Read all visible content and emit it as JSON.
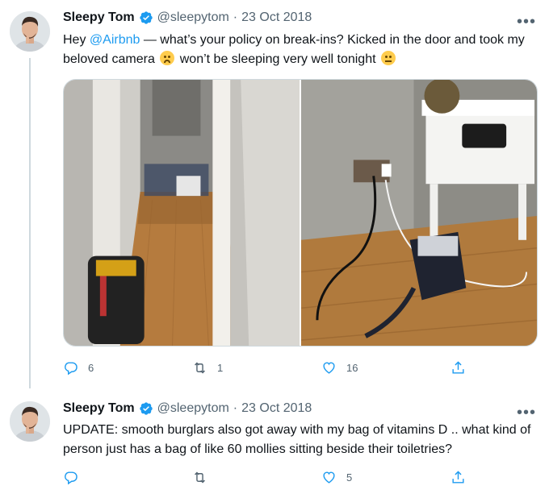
{
  "tweets": [
    {
      "author": {
        "name": "Sleepy Tom",
        "handle": "@sleepytom"
      },
      "date": "23 Oct 2018",
      "separator": "·",
      "more_label": "•••",
      "text": {
        "part1": "Hey ",
        "mention": "@Airbnb",
        "part2": " — what’s your policy on break-ins? Kicked in the door and took my beloved camera ",
        "emoji1": "disappointed-face-emoji",
        "part3": " won’t be sleeping very well tonight ",
        "emoji2": "neutral-face-emoji"
      },
      "stats": {
        "replies": "6",
        "retweets": "1",
        "likes": "16"
      }
    },
    {
      "author": {
        "name": "Sleepy Tom",
        "handle": "@sleepytom"
      },
      "date": "23 Oct 2018",
      "separator": "·",
      "more_label": "•••",
      "text": {
        "part1": "UPDATE: smooth burglars also got away with my bag of vitamins D .. what kind of person just has a bag of like 60 mollies sitting beside their toiletries?"
      },
      "stats": {
        "replies": "",
        "retweets": "",
        "likes": "5"
      }
    }
  ],
  "colors": {
    "accent": "#1d9bf0",
    "text": "#0f1419",
    "secondary": "#536471",
    "thread_line": "#cfd9de"
  },
  "icons": [
    "verified-badge-icon",
    "more-icon",
    "reply-icon",
    "retweet-icon",
    "like-icon",
    "share-icon"
  ]
}
